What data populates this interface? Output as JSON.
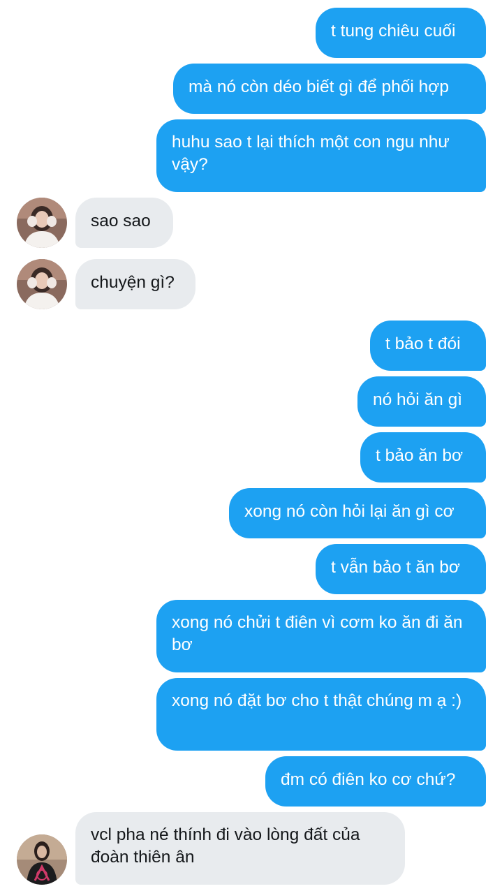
{
  "messages": [
    {
      "side": "out",
      "text": "t tung chiêu cuối"
    },
    {
      "side": "out",
      "text": "mà nó còn déo biết gì để phối hợp"
    },
    {
      "side": "out",
      "text": "huhu sao t lại thích một con ngu như vậy?"
    },
    {
      "side": "in",
      "text": "sao sao",
      "avatar": "user-a-avatar"
    },
    {
      "side": "in",
      "text": "chuyện gì?",
      "avatar": "user-a-avatar"
    },
    {
      "side": "out",
      "text": "t bảo t đói"
    },
    {
      "side": "out",
      "text": "nó hỏi ăn gì"
    },
    {
      "side": "out",
      "text": "t bảo ăn bơ"
    },
    {
      "side": "out",
      "text": "xong nó còn hỏi lại ăn gì cơ"
    },
    {
      "side": "out",
      "text": "t vẫn bảo t ăn bơ"
    },
    {
      "side": "out",
      "text": "xong nó chửi t điên vì cơm ko ăn đi ăn bơ"
    },
    {
      "side": "out",
      "text": "xong nó đặt bơ cho t thật chúng m ạ :)"
    },
    {
      "side": "out",
      "text": "đm có điên ko cơ chứ?"
    },
    {
      "side": "in",
      "text": "vcl pha né thính đi vào lòng đất của đoàn thiên ân",
      "avatar": "user-b-avatar"
    }
  ],
  "colors": {
    "outgoing_bubble": "#1da1f2",
    "incoming_bubble": "#e8ebee",
    "outgoing_text": "#ffffff",
    "incoming_text": "#14171a"
  }
}
